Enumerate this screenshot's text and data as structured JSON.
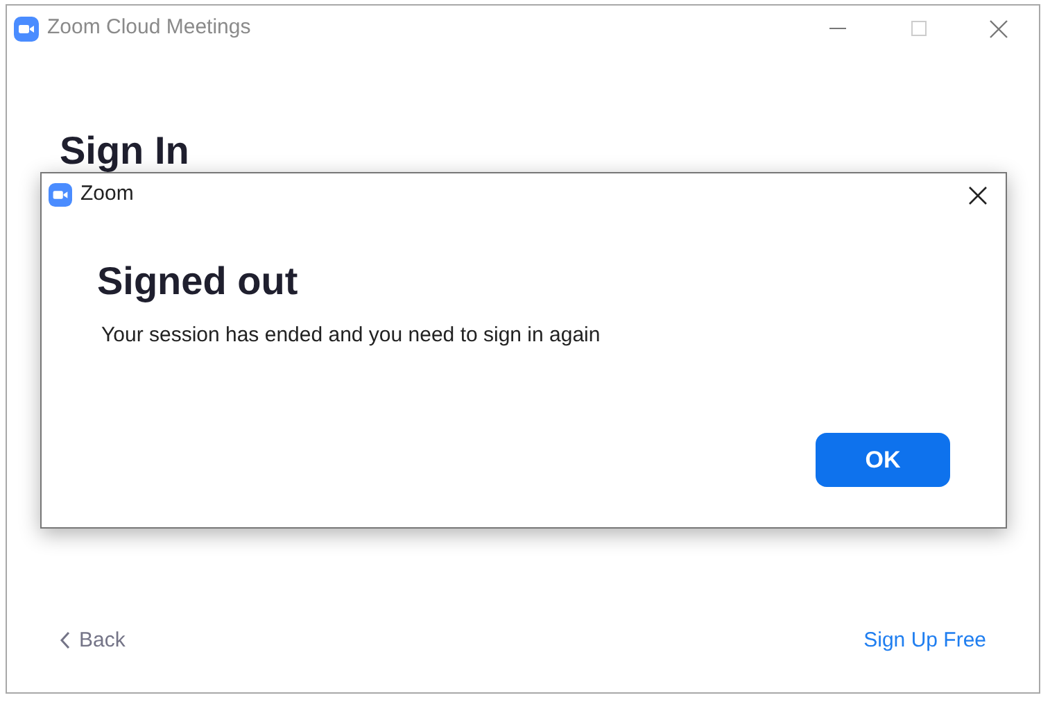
{
  "window": {
    "title": "Zoom Cloud Meetings"
  },
  "page": {
    "heading": "Sign In",
    "back_link": "Back",
    "signup_link": "Sign Up Free"
  },
  "dialog": {
    "title": "Zoom",
    "heading": "Signed out",
    "message": "Your session has ended and you need to sign in again",
    "buttons": [
      "OK"
    ]
  }
}
